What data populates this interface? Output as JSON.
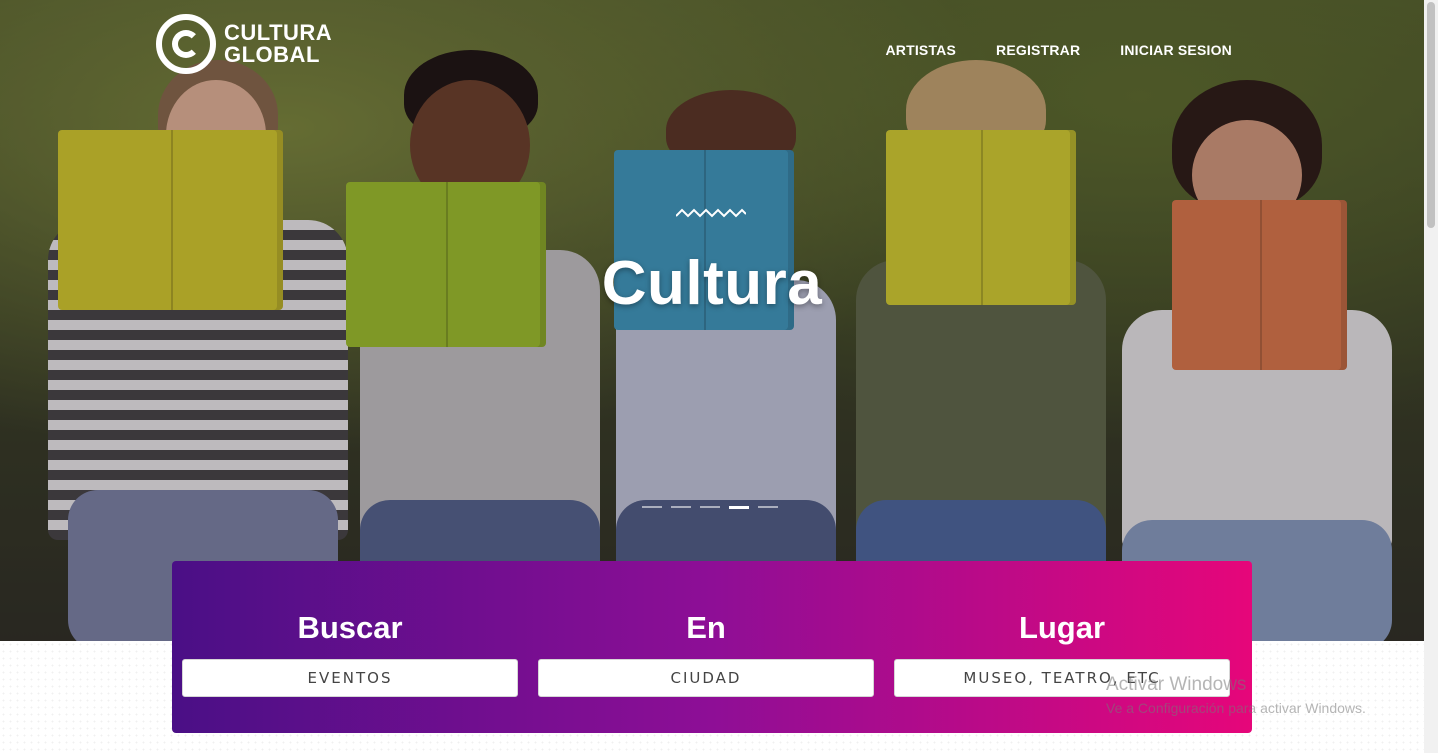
{
  "header": {
    "logo": {
      "line1": "CULTURA",
      "line2": "GLOBAL",
      "icon": "globe-logo-icon"
    },
    "nav": [
      {
        "label": "ARTISTAS"
      },
      {
        "label": "REGISTRAR"
      },
      {
        "label": "INICIAR SESION"
      }
    ]
  },
  "hero": {
    "title": "Cultura",
    "slides_total": 5,
    "active_slide": 4
  },
  "search": {
    "columns": [
      {
        "label": "Buscar",
        "placeholder": "EVENTOS"
      },
      {
        "label": "En",
        "placeholder": "CIUDAD"
      },
      {
        "label": "Lugar",
        "placeholder": "MUSEO, TEATRO, ETC"
      }
    ]
  },
  "overlay": {
    "title": "Activar Windows",
    "subtitle": "Ve a Configuración para activar Windows."
  },
  "colors": {
    "gradient_start": "#4a0f86",
    "gradient_mid": "#8e0e96",
    "gradient_end": "#e6067a"
  }
}
